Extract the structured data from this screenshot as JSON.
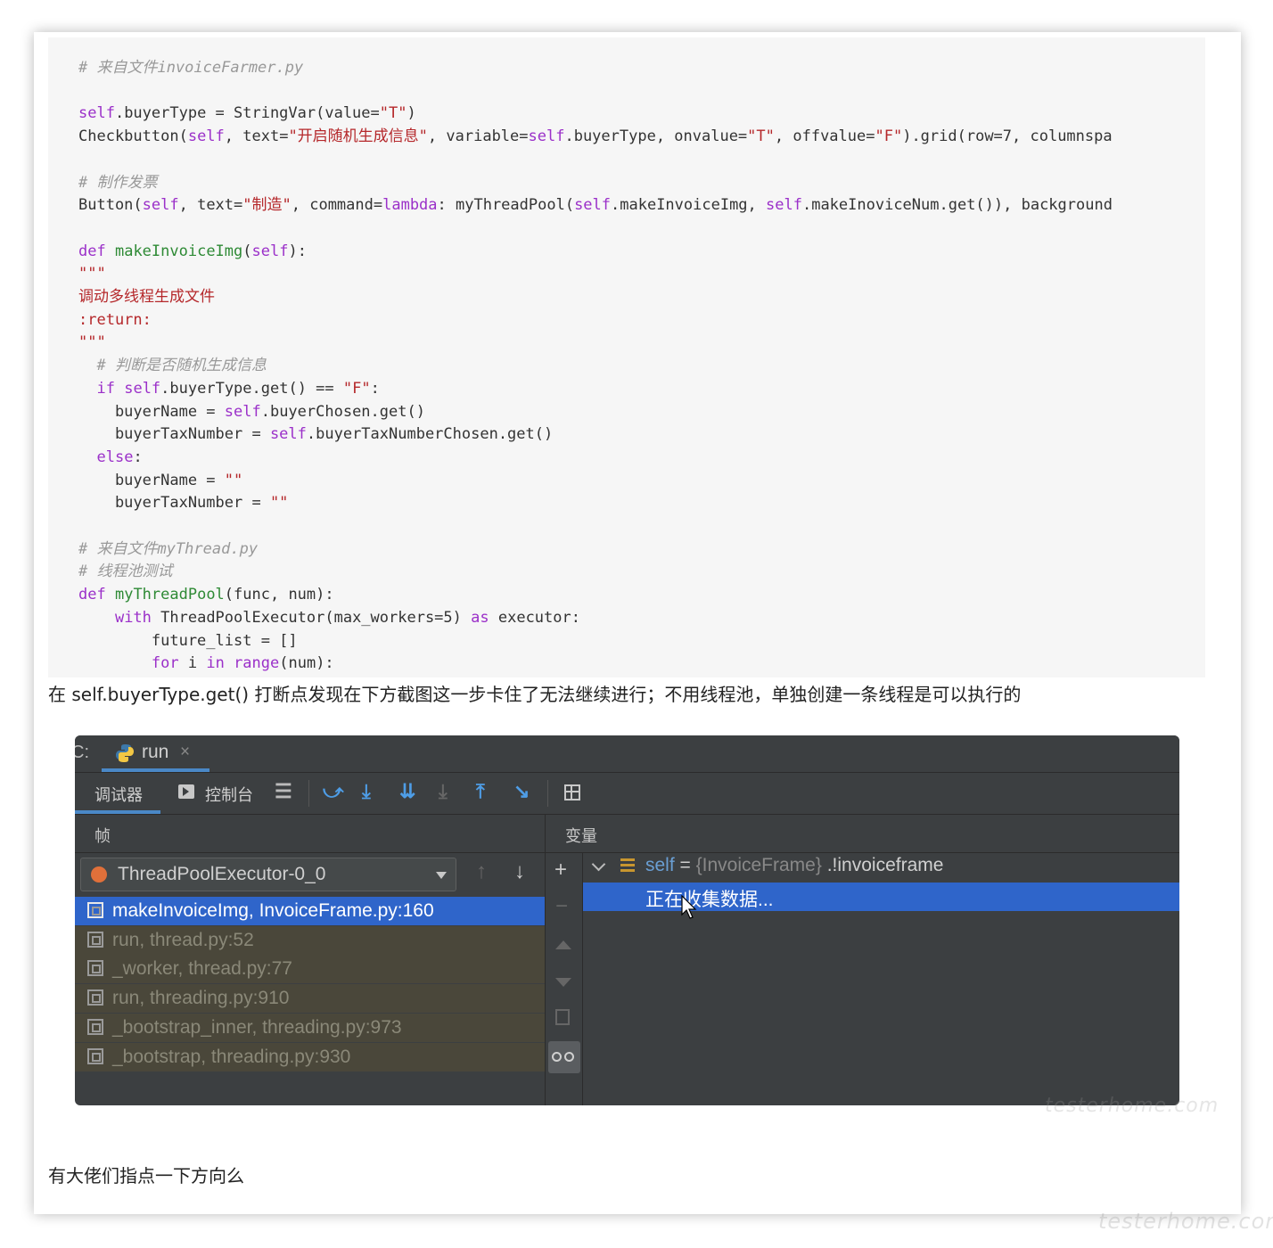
{
  "code_block": {
    "comment_source1": "# 来自文件invoiceFarmer.py",
    "line_buyer_type_self": "self",
    "line_buyer_type_rest": ".buyerType = StringVar(value=",
    "line_buyer_type_val": "\"T\"",
    "line_buyer_type_end": ")",
    "checkbutton_text": "\"开启随机生成信息\"",
    "comment_make_invoice": "# 制作发票",
    "button_text": "\"制造\"",
    "docstring_text": "调动多线程生成文件",
    "docstring_return": ":return:",
    "comment_judge": "# 判断是否随机生成信息",
    "comment_source2": "# 来自文件myThread.py",
    "comment_pool_test": "# 线程池测试"
  },
  "question_text": "在 self.buyerType.get() 打断点发现在下方截图这一步卡住了无法继续进行；不用线程池，单独创建一条线程是可以执行的",
  "closing_text": "有大佬们指点一下方向么",
  "debugger": {
    "tab_prefix": "C:",
    "run_tab_label": "run",
    "run_tab_close": "×",
    "debugger_tab": "调试器",
    "console_tab": "控制台",
    "frames_header": "帧",
    "variables_header": "变量",
    "thread_name": "ThreadPoolExecutor-0_0",
    "frames": [
      {
        "label": "makeInvoiceImg, InvoiceFrame.py:160",
        "selected": true
      },
      {
        "label": "run, thread.py:52",
        "selected": false
      },
      {
        "label": "_worker, thread.py:77",
        "selected": false
      },
      {
        "label": "run, threading.py:910",
        "selected": false
      },
      {
        "label": "_bootstrap_inner, threading.py:973",
        "selected": false
      },
      {
        "label": "_bootstrap, threading.py:930",
        "selected": false
      }
    ],
    "variable_self_name": "self",
    "variable_self_eq": " = ",
    "variable_self_type": "{InvoiceFrame}",
    "variable_self_value": " .!invoiceframe",
    "collecting_text": "正在收集数据..."
  },
  "watermark": "testerhome.com",
  "colors": {
    "ide_bg": "#3c3f41",
    "selection": "#2f65ca",
    "inactive_frame_bg": "#4a473a"
  }
}
